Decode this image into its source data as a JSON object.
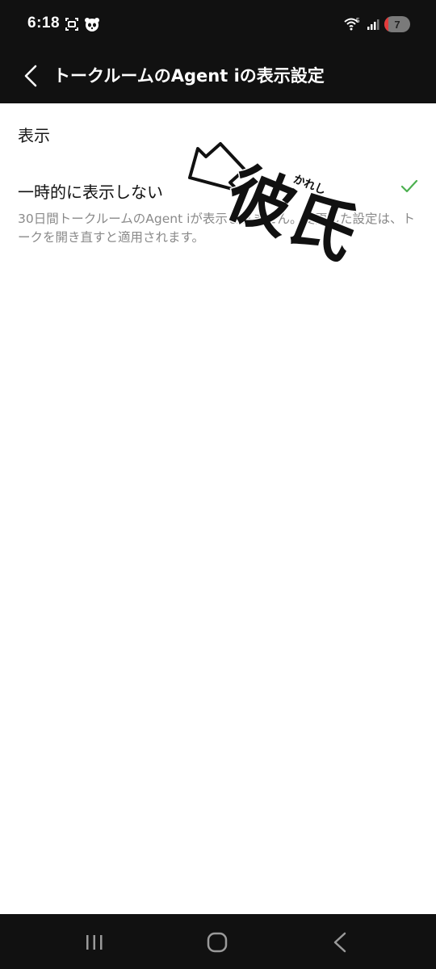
{
  "status_bar": {
    "time": "6:18",
    "network_label": "5",
    "battery_level": "7"
  },
  "header": {
    "title": "トークルームのAgent iの表示設定",
    "back_icon": "chevron-left-icon"
  },
  "section": {
    "title": "表示"
  },
  "option": {
    "label": "一時的に表示しない",
    "selected": true,
    "description": "30日間トークルームのAgent iが表示されません。変更した設定は、トークを開き直すと適用されます。"
  },
  "overlay": {
    "text": "彼氏",
    "ruby": "かれし"
  },
  "colors": {
    "bar_background": "#111111",
    "check": "#4cb050",
    "description": "#8a8a8a"
  },
  "nav_bar": {
    "icons": [
      "recent-apps-icon",
      "home-icon",
      "back-icon"
    ]
  }
}
